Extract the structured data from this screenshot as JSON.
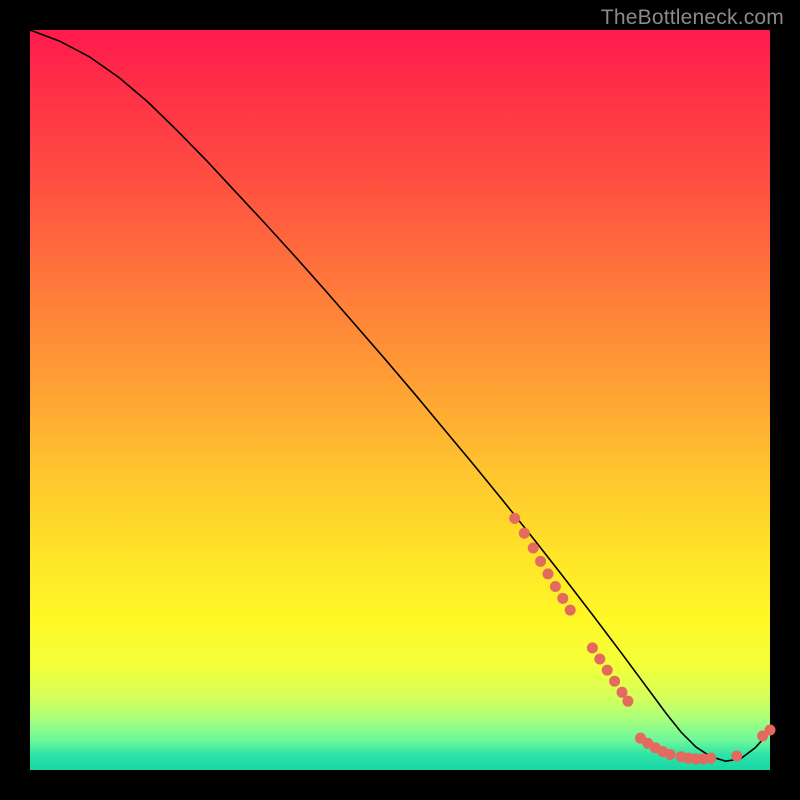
{
  "watermark": "TheBottleneck.com",
  "chart_data": {
    "type": "line",
    "title": "",
    "xlabel": "",
    "ylabel": "",
    "xlim": [
      0,
      100
    ],
    "ylim": [
      0,
      100
    ],
    "grid": false,
    "legend": false,
    "series": [
      {
        "name": "bottleneck-curve",
        "x": [
          0,
          4,
          8,
          12,
          16,
          20,
          24,
          28,
          32,
          36,
          40,
          44,
          48,
          52,
          56,
          60,
          64,
          68,
          72,
          76,
          80,
          82,
          84,
          86,
          88,
          90,
          92,
          94,
          96,
          98,
          100
        ],
        "y": [
          100,
          98.5,
          96.4,
          93.6,
          90.2,
          86.3,
          82.2,
          77.9,
          73.6,
          69.2,
          64.7,
          60.1,
          55.5,
          50.8,
          46.0,
          41.2,
          36.3,
          31.3,
          26.2,
          21.0,
          15.7,
          13.0,
          10.3,
          7.6,
          5.1,
          3.1,
          1.8,
          1.2,
          1.5,
          3.0,
          5.2
        ],
        "stroke": "#000000",
        "stroke_width": 1.6
      }
    ],
    "points": {
      "name": "markers",
      "fill": "#e4695f",
      "radius": 5.5,
      "xy": [
        [
          65.5,
          34.0
        ],
        [
          66.8,
          32.0
        ],
        [
          68.0,
          30.0
        ],
        [
          69.0,
          28.2
        ],
        [
          70.0,
          26.5
        ],
        [
          71.0,
          24.8
        ],
        [
          72.0,
          23.2
        ],
        [
          73.0,
          21.6
        ],
        [
          76.0,
          16.5
        ],
        [
          77.0,
          15.0
        ],
        [
          78.0,
          13.5
        ],
        [
          79.0,
          12.0
        ],
        [
          80.0,
          10.5
        ],
        [
          80.8,
          9.3
        ],
        [
          82.5,
          4.3
        ],
        [
          83.5,
          3.6
        ],
        [
          84.5,
          3.0
        ],
        [
          85.5,
          2.5
        ],
        [
          86.5,
          2.1
        ],
        [
          88.0,
          1.8
        ],
        [
          89.0,
          1.6
        ],
        [
          90.0,
          1.5
        ],
        [
          91.0,
          1.5
        ],
        [
          92.0,
          1.6
        ],
        [
          95.5,
          1.9
        ],
        [
          99.0,
          4.6
        ],
        [
          100.0,
          5.4
        ]
      ]
    }
  }
}
